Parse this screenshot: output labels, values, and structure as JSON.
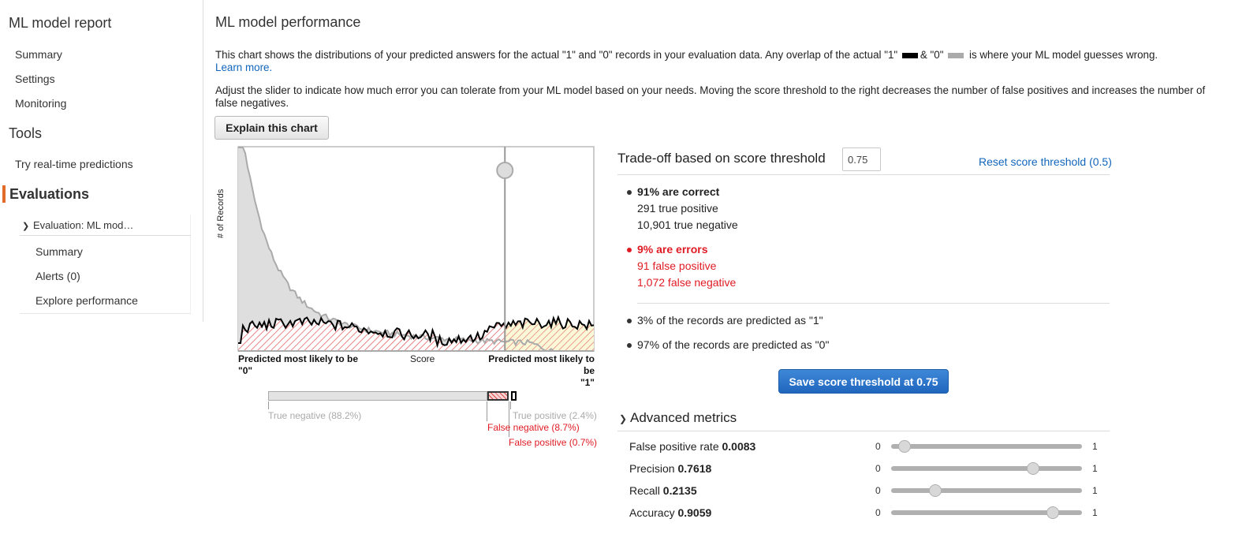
{
  "sidebar": {
    "report_title": "ML model report",
    "report_items": [
      "Summary",
      "Settings",
      "Monitoring"
    ],
    "tools_title": "Tools",
    "tools_items": [
      "Try real-time predictions"
    ],
    "evaluations_title": "Evaluations",
    "evaluation_label": "Evaluation: ML mod…",
    "evaluation_items": [
      "Summary",
      "Alerts (0)",
      "Explore performance"
    ]
  },
  "main": {
    "title": "ML model performance",
    "para1_a": "This chart shows the distributions of your predicted answers for the actual \"1\" and \"0\" records in your evaluation data. Any overlap of the actual \"1\"",
    "para1_b": "& \"0\"",
    "para1_c": "is where your ML model guesses wrong.",
    "learn_more": "Learn more.",
    "para2": "Adjust the slider to indicate how much error you can tolerate from your ML model based on your needs. Moving the score threshold to the right decreases the number of false positives and increases the number of false negatives.",
    "explain_button": "Explain this chart"
  },
  "chart_data": {
    "type": "area",
    "ylabel": "# of Records",
    "xlabel": "Score",
    "x_left_label": [
      "Predicted most likely to be",
      "\"0\""
    ],
    "x_right_label": [
      "Predicted most likely to be",
      "\"1\""
    ],
    "xlim": [
      0,
      1
    ],
    "threshold": 0.75,
    "series": [
      {
        "name": "actual \"0\"",
        "color": "#aaaaaa",
        "fill": "#dddddd"
      },
      {
        "name": "actual \"1\"",
        "color": "#000000"
      }
    ]
  },
  "distribution_bar": {
    "true_negative": "True negative (88.2%)",
    "false_negative": "False negative (8.7%)",
    "true_positive": "True positive (2.4%)",
    "false_positive": "False positive (0.7%)",
    "values": {
      "true_negative": 88.2,
      "false_negative": 8.7,
      "true_positive": 2.4,
      "false_positive": 0.7
    }
  },
  "tradeoff": {
    "title": "Trade-off based on score threshold",
    "threshold_value": "0.75",
    "reset_link": "Reset score threshold (0.5)",
    "correct_header": "91% are correct",
    "true_positive": "291 true positive",
    "true_negative": "10,901 true negative",
    "errors_header": "9% are errors",
    "false_positive": "91 false positive",
    "false_negative": "1,072 false negative",
    "pred_one": "3% of the records are predicted as \"1\"",
    "pred_zero": "97% of the records are predicted as \"0\"",
    "save_button": "Save score threshold at 0.75"
  },
  "advanced": {
    "title": "Advanced metrics",
    "min_label": "0",
    "max_label": "1",
    "metrics": [
      {
        "label": "False positive rate",
        "value": "0.0083",
        "level": 0.0083
      },
      {
        "label": "Precision",
        "value": "0.7618",
        "level": 0.7618
      },
      {
        "label": "Recall",
        "value": "0.2135",
        "level": 0.2135
      },
      {
        "label": "Accuracy",
        "value": "0.9059",
        "level": 0.9059
      }
    ]
  },
  "colors": {
    "accent": "#e26b2a",
    "link": "#1166bb",
    "error": "#e01b24",
    "primary_button": "#2a72c8"
  }
}
